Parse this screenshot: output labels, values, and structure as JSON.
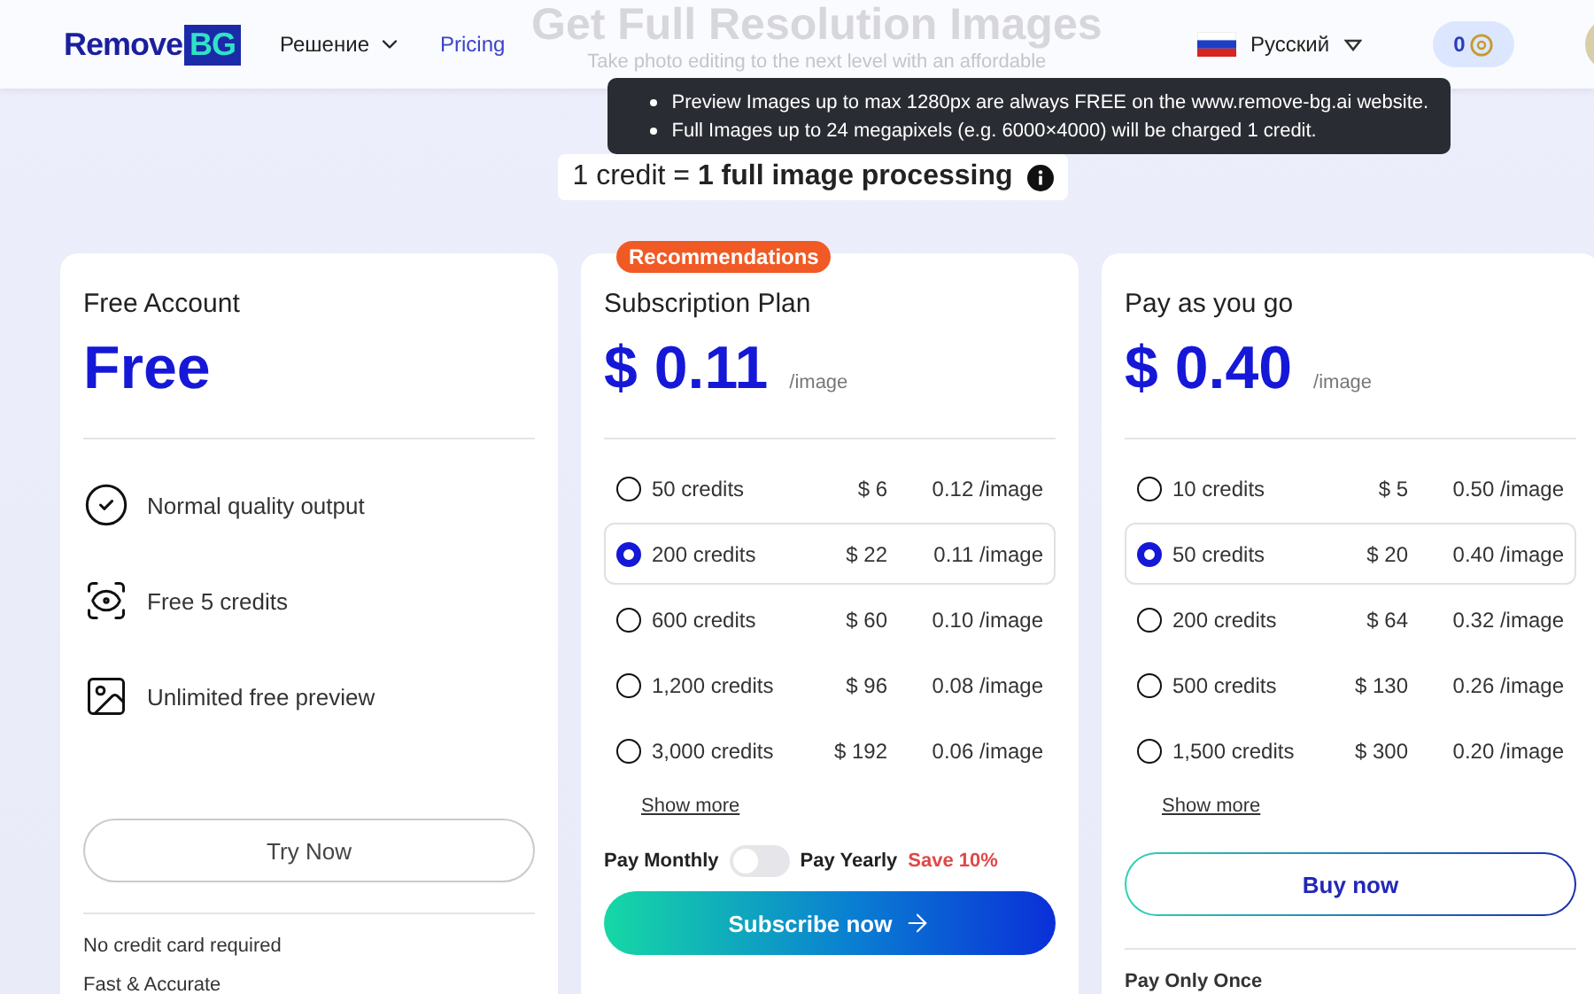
{
  "header": {
    "logo": {
      "word": "Remove",
      "mark": "BG"
    },
    "nav": [
      {
        "label": "Решение",
        "kind": "dropdown"
      },
      {
        "label": "Pricing",
        "kind": "link"
      }
    ],
    "language": "Русский",
    "credits": "0"
  },
  "hero": {
    "title": "Get Full Resolution Images",
    "subtitle": "Take photo editing to the next level with an affordable"
  },
  "tooltip": {
    "lines": [
      "Preview Images up to max 1280px are always FREE on the www.remove-bg.ai website.",
      "Full Images up to 24 megapixels (e.g. 6000×4000) will be charged 1 credit."
    ]
  },
  "credit_note": "1 credit = **1 full image processing**",
  "plans": [
    {
      "kind": "free",
      "title": "Free Account",
      "price": "Free",
      "features": [
        {
          "kind": "check",
          "text": "Normal quality output"
        },
        {
          "kind": "eye",
          "text": "Free 5 credits"
        },
        {
          "kind": "image",
          "text": "Unlimited free preview"
        }
      ],
      "button": "Try Now",
      "notes": [
        "No credit card required",
        "Fast & Accurate"
      ]
    },
    {
      "kind": "subscription",
      "badge": "Recommendations",
      "title": "Subscription Plan",
      "price": "$ 0.11",
      "unit": "/image",
      "options": [
        {
          "credits": "50 credits",
          "price": "$ 6",
          "per_image": "0.12 /image",
          "selected": false
        },
        {
          "credits": "200 credits",
          "price": "$ 22",
          "per_image": "0.11 /image",
          "selected": true
        },
        {
          "credits": "600 credits",
          "price": "$ 60",
          "per_image": "0.10 /image",
          "selected": false
        },
        {
          "credits": "1,200 credits",
          "price": "$ 96",
          "per_image": "0.08 /image",
          "selected": false
        },
        {
          "credits": "3,000 credits",
          "price": "$ 192",
          "per_image": "0.06 /image",
          "selected": false
        }
      ],
      "show_more": "Show more",
      "billing": {
        "monthly": "Pay Monthly",
        "yearly": "Pay Yearly",
        "save": "Save 10%",
        "on": false
      },
      "button": "Subscribe now"
    },
    {
      "kind": "payg",
      "title": "Pay as you go",
      "price": "$ 0.40",
      "unit": "/image",
      "options": [
        {
          "credits": "10 credits",
          "price": "$ 5",
          "per_image": "0.50 /image",
          "selected": false
        },
        {
          "credits": "50 credits",
          "price": "$ 20",
          "per_image": "0.40 /image",
          "selected": true
        },
        {
          "credits": "200 credits",
          "price": "$ 64",
          "per_image": "0.32 /image",
          "selected": false
        },
        {
          "credits": "500 credits",
          "price": "$ 130",
          "per_image": "0.26 /image",
          "selected": false
        },
        {
          "credits": "1,500 credits",
          "price": "$ 300",
          "per_image": "0.20 /image",
          "selected": false
        }
      ],
      "show_more": "Show more",
      "button": "Buy now",
      "notes": [
        "Pay Only Once"
      ]
    }
  ]
}
